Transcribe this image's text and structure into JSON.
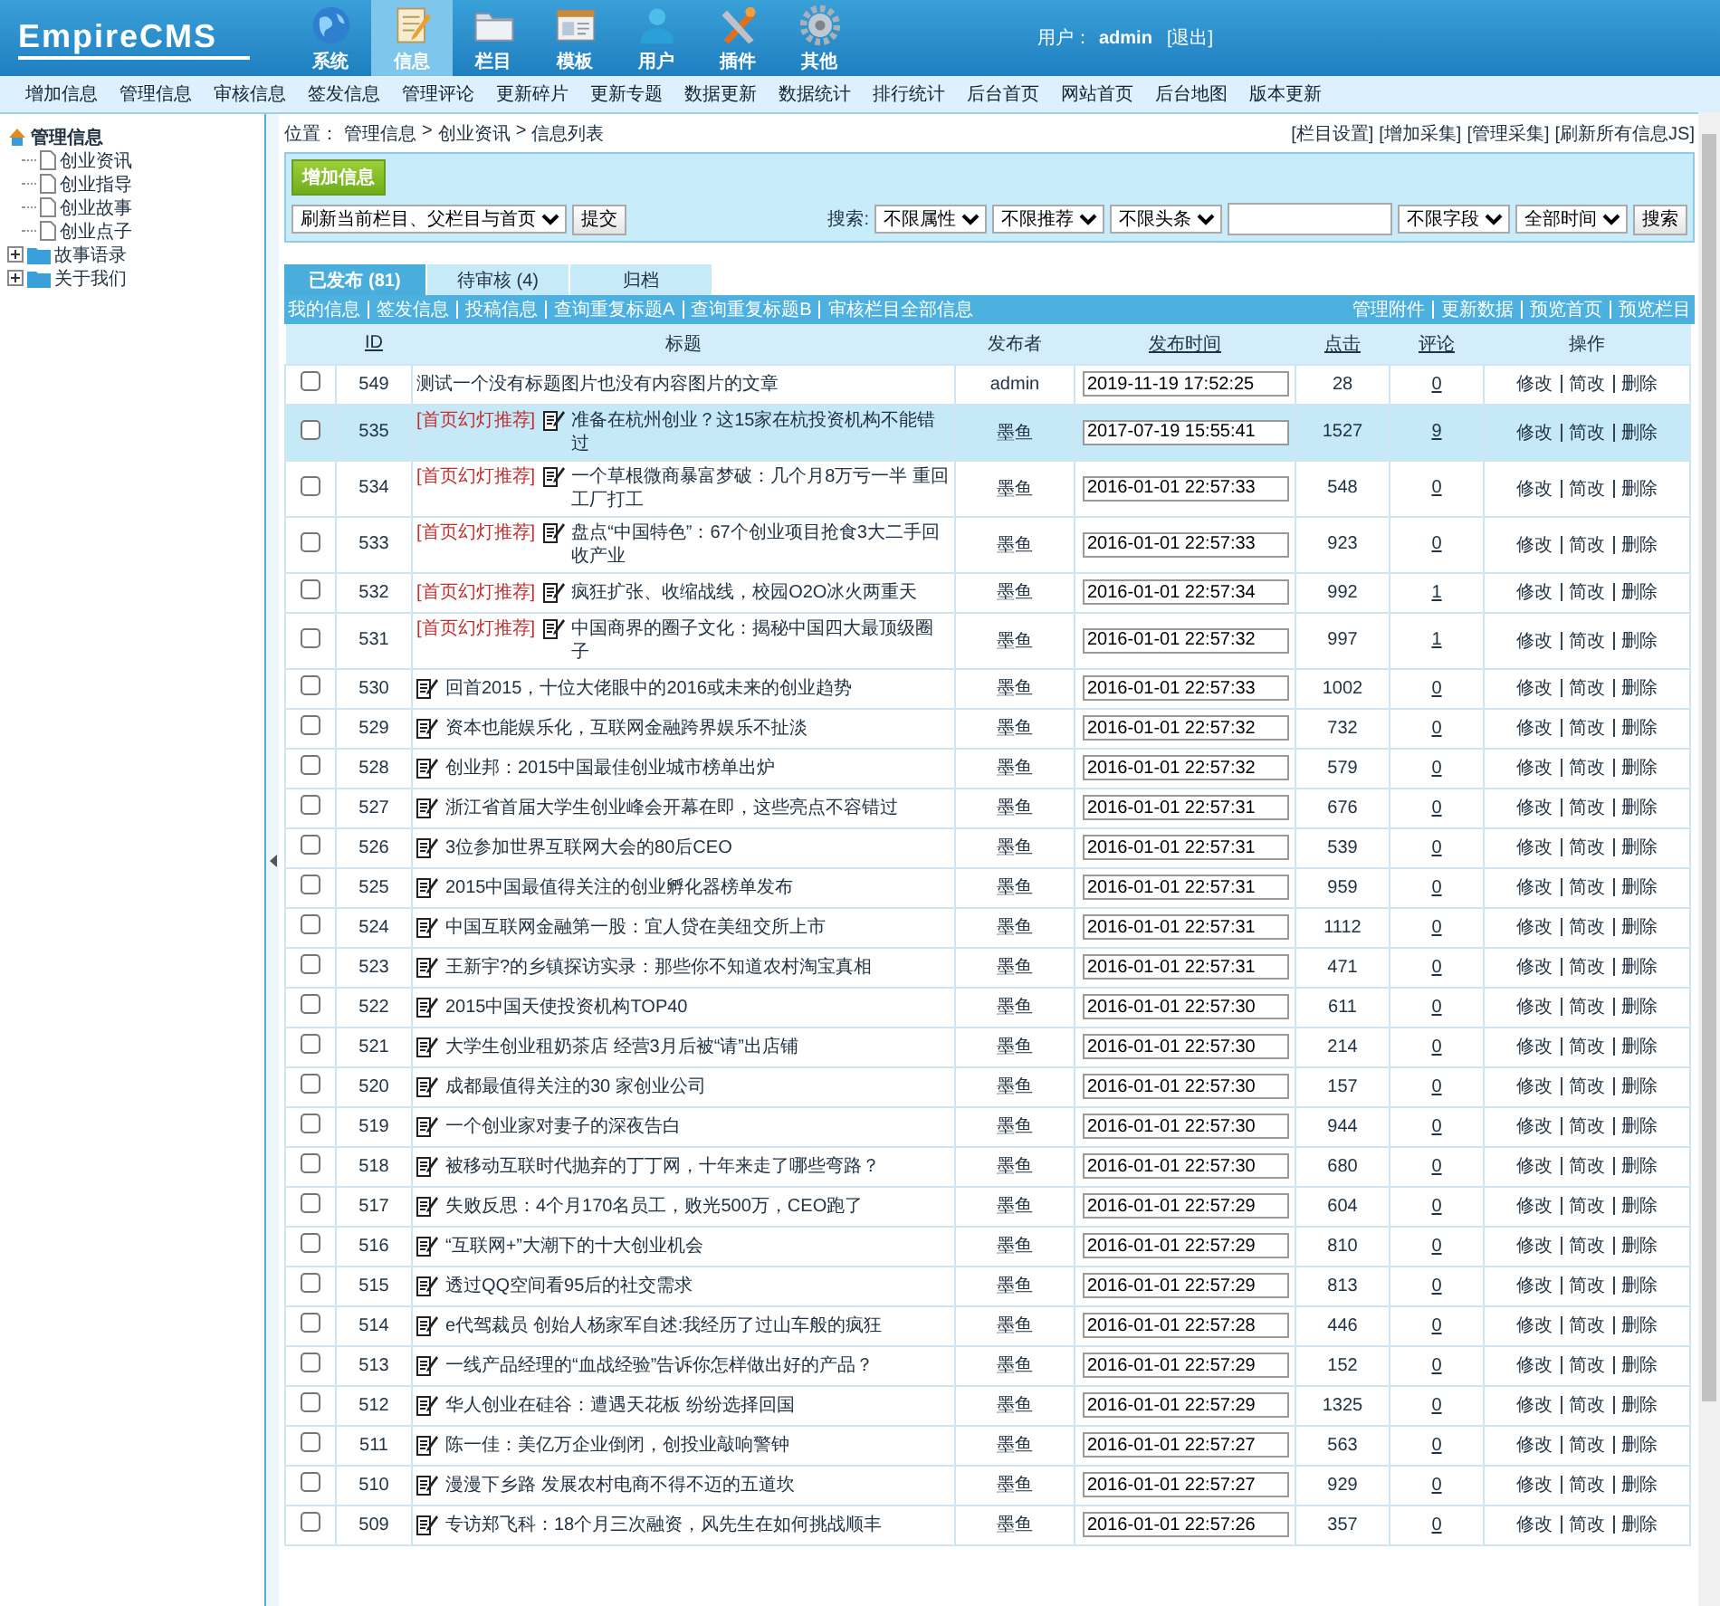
{
  "header": {
    "logo": "EmpireCMS",
    "main_nav": [
      {
        "label": "系统",
        "selected": false
      },
      {
        "label": "信息",
        "selected": true
      },
      {
        "label": "栏目",
        "selected": false
      },
      {
        "label": "模板",
        "selected": false
      },
      {
        "label": "用户",
        "selected": false
      },
      {
        "label": "插件",
        "selected": false
      },
      {
        "label": "其他",
        "selected": false
      }
    ],
    "user_label": "用户：",
    "user_name": "admin",
    "logout": "[退出]"
  },
  "sub_nav": [
    "增加信息",
    "管理信息",
    "审核信息",
    "签发信息",
    "管理评论",
    "更新碎片",
    "更新专题",
    "数据更新",
    "数据统计",
    "排行统计",
    "后台首页",
    "网站首页",
    "后台地图",
    "版本更新"
  ],
  "sidebar": {
    "tree": [
      {
        "label": "管理信息",
        "expanded": true,
        "children": [
          {
            "label": "创业资讯"
          },
          {
            "label": "创业指导"
          },
          {
            "label": "创业故事"
          },
          {
            "label": "创业点子"
          }
        ]
      },
      {
        "label": "故事语录",
        "expanded": false
      },
      {
        "label": "关于我们",
        "expanded": false
      }
    ]
  },
  "breadcrumb": {
    "prefix": "位置：",
    "items": [
      {
        "label": "管理信息"
      },
      {
        "separator": ">",
        "label": "创业资讯"
      },
      {
        "separator": ">",
        "label": "信息列表"
      }
    ]
  },
  "top_links": [
    "[栏目设置]",
    "[增加采集]",
    "[管理采集]",
    "[刷新所有信息JS]"
  ],
  "add_button": "增加信息",
  "refresh": {
    "select": "刷新当前栏目、父栏目与首页",
    "button": "提交"
  },
  "search": {
    "label": "搜索:",
    "filters": [
      "不限属性",
      "不限推荐",
      "不限头条"
    ],
    "field_select": "不限字段",
    "time_select": "全部时间",
    "button": "搜索"
  },
  "tabs": [
    {
      "label": "已发布 (81)",
      "selected": true
    },
    {
      "label": "待审核 (4)",
      "selected": false
    },
    {
      "label": "归档",
      "selected": false
    }
  ],
  "left_links": [
    "我的信息",
    "签发信息",
    "投稿信息",
    "查询重复标题A",
    "查询重复标题B",
    "审核栏目全部信息"
  ],
  "right_links": [
    "管理附件",
    "更新数据",
    "预览首页",
    "预览栏目"
  ],
  "columns": [
    {
      "label": "ID",
      "sortable": true
    },
    {
      "label": "标题",
      "sortable": false
    },
    {
      "label": "发布者",
      "sortable": false
    },
    {
      "label": "发布时间",
      "sortable": true
    },
    {
      "label": "点击",
      "sortable": true
    },
    {
      "label": "评论",
      "sortable": true
    },
    {
      "label": "操作",
      "sortable": false
    }
  ],
  "rows": [
    {
      "id": "549",
      "title": "测试一个没有标题图片也没有内容图片的文章",
      "has_image": false,
      "publisher": "admin",
      "time": "2019-11-19 17:52:25",
      "hits": "28",
      "comments": "0",
      "checked": false,
      "selected": false,
      "actions": [
        "修改",
        "简改",
        "删除"
      ]
    },
    {
      "id": "535",
      "tag": "[首页幻灯推荐]",
      "title": "准备在杭州创业？这15家在杭投资机构不能错过",
      "has_image": true,
      "publisher": "墨鱼",
      "time": "2017-07-19 15:55:41",
      "hits": "1527",
      "comments": "9",
      "checked": false,
      "selected": true,
      "actions": [
        "修改",
        "简改",
        "删除"
      ]
    },
    {
      "id": "534",
      "tag": "[首页幻灯推荐]",
      "title": "一个草根微商暴富梦破：几个月8万亏一半 重回工厂打工",
      "has_image": true,
      "publisher": "墨鱼",
      "time": "2016-01-01 22:57:33",
      "hits": "548",
      "comments": "0",
      "checked": false,
      "selected": false,
      "actions": [
        "修改",
        "简改",
        "删除"
      ]
    },
    {
      "id": "533",
      "tag": "[首页幻灯推荐]",
      "title": "盘点“中国特色”：67个创业项目抢食3大二手回收产业",
      "has_image": true,
      "publisher": "墨鱼",
      "time": "2016-01-01 22:57:33",
      "hits": "923",
      "comments": "0",
      "checked": false,
      "selected": false,
      "actions": [
        "修改",
        "简改",
        "删除"
      ]
    },
    {
      "id": "532",
      "tag": "[首页幻灯推荐]",
      "title": "疯狂扩张、收缩战线，校园O2O冰火两重天",
      "has_image": true,
      "publisher": "墨鱼",
      "time": "2016-01-01 22:57:34",
      "hits": "992",
      "comments": "1",
      "checked": false,
      "selected": false,
      "actions": [
        "修改",
        "简改",
        "删除"
      ]
    },
    {
      "id": "531",
      "tag": "[首页幻灯推荐]",
      "title": "中国商界的圈子文化：揭秘中国四大最顶级圈子",
      "has_image": true,
      "publisher": "墨鱼",
      "time": "2016-01-01 22:57:32",
      "hits": "997",
      "comments": "1",
      "checked": false,
      "selected": false,
      "actions": [
        "修改",
        "简改",
        "删除"
      ]
    },
    {
      "id": "530",
      "title": "回首2015，十位大佬眼中的2016或未来的创业趋势",
      "has_image": true,
      "publisher": "墨鱼",
      "time": "2016-01-01 22:57:33",
      "hits": "1002",
      "comments": "0",
      "checked": false,
      "selected": false,
      "actions": [
        "修改",
        "简改",
        "删除"
      ]
    },
    {
      "id": "529",
      "title": "资本也能娱乐化，互联网金融跨界娱乐不扯淡",
      "has_image": true,
      "publisher": "墨鱼",
      "time": "2016-01-01 22:57:32",
      "hits": "732",
      "comments": "0",
      "checked": false,
      "selected": false,
      "actions": [
        "修改",
        "简改",
        "删除"
      ]
    },
    {
      "id": "528",
      "title": "创业邦：2015中国最佳创业城市榜单出炉",
      "has_image": true,
      "publisher": "墨鱼",
      "time": "2016-01-01 22:57:32",
      "hits": "579",
      "comments": "0",
      "checked": false,
      "selected": false,
      "actions": [
        "修改",
        "简改",
        "删除"
      ]
    },
    {
      "id": "527",
      "title": "浙江省首届大学生创业峰会开幕在即，这些亮点不容错过",
      "has_image": true,
      "publisher": "墨鱼",
      "time": "2016-01-01 22:57:31",
      "hits": "676",
      "comments": "0",
      "checked": false,
      "selected": false,
      "actions": [
        "修改",
        "简改",
        "删除"
      ]
    },
    {
      "id": "526",
      "title": "3位参加世界互联网大会的80后CEO",
      "has_image": true,
      "publisher": "墨鱼",
      "time": "2016-01-01 22:57:31",
      "hits": "539",
      "comments": "0",
      "checked": false,
      "selected": false,
      "actions": [
        "修改",
        "简改",
        "删除"
      ]
    },
    {
      "id": "525",
      "title": "2015中国最值得关注的创业孵化器榜单发布",
      "has_image": true,
      "publisher": "墨鱼",
      "time": "2016-01-01 22:57:31",
      "hits": "959",
      "comments": "0",
      "checked": false,
      "selected": false,
      "actions": [
        "修改",
        "简改",
        "删除"
      ]
    },
    {
      "id": "524",
      "title": "中国互联网金融第一股：宜人贷在美纽交所上市",
      "has_image": true,
      "publisher": "墨鱼",
      "time": "2016-01-01 22:57:31",
      "hits": "1112",
      "comments": "0",
      "checked": false,
      "selected": false,
      "actions": [
        "修改",
        "简改",
        "删除"
      ]
    },
    {
      "id": "523",
      "title": "王新宇?的乡镇探访实录：那些你不知道农村淘宝真相",
      "has_image": true,
      "publisher": "墨鱼",
      "time": "2016-01-01 22:57:31",
      "hits": "471",
      "comments": "0",
      "checked": false,
      "selected": false,
      "actions": [
        "修改",
        "简改",
        "删除"
      ]
    },
    {
      "id": "522",
      "title": "2015中国天使投资机构TOP40",
      "has_image": true,
      "publisher": "墨鱼",
      "time": "2016-01-01 22:57:30",
      "hits": "611",
      "comments": "0",
      "checked": false,
      "selected": false,
      "actions": [
        "修改",
        "简改",
        "删除"
      ]
    },
    {
      "id": "521",
      "title": "大学生创业租奶茶店 经营3月后被“请”出店铺",
      "has_image": true,
      "publisher": "墨鱼",
      "time": "2016-01-01 22:57:30",
      "hits": "214",
      "comments": "0",
      "checked": false,
      "selected": false,
      "actions": [
        "修改",
        "简改",
        "删除"
      ]
    },
    {
      "id": "520",
      "title": "成都最值得关注的30 家创业公司",
      "has_image": true,
      "publisher": "墨鱼",
      "time": "2016-01-01 22:57:30",
      "hits": "157",
      "comments": "0",
      "checked": false,
      "selected": false,
      "actions": [
        "修改",
        "简改",
        "删除"
      ]
    },
    {
      "id": "519",
      "title": "一个创业家对妻子的深夜告白",
      "has_image": true,
      "publisher": "墨鱼",
      "time": "2016-01-01 22:57:30",
      "hits": "944",
      "comments": "0",
      "checked": false,
      "selected": false,
      "actions": [
        "修改",
        "简改",
        "删除"
      ]
    },
    {
      "id": "518",
      "title": "被移动互联时代抛弃的丁丁网，十年来走了哪些弯路？",
      "has_image": true,
      "publisher": "墨鱼",
      "time": "2016-01-01 22:57:30",
      "hits": "680",
      "comments": "0",
      "checked": false,
      "selected": false,
      "actions": [
        "修改",
        "简改",
        "删除"
      ]
    },
    {
      "id": "517",
      "title": "失败反思：4个月170名员工，败光500万，CEO跑了",
      "has_image": true,
      "publisher": "墨鱼",
      "time": "2016-01-01 22:57:29",
      "hits": "604",
      "comments": "0",
      "checked": false,
      "selected": false,
      "actions": [
        "修改",
        "简改",
        "删除"
      ]
    },
    {
      "id": "516",
      "title": "“互联网+”大潮下的十大创业机会",
      "has_image": true,
      "publisher": "墨鱼",
      "time": "2016-01-01 22:57:29",
      "hits": "810",
      "comments": "0",
      "checked": false,
      "selected": false,
      "actions": [
        "修改",
        "简改",
        "删除"
      ]
    },
    {
      "id": "515",
      "title": "透过QQ空间看95后的社交需求",
      "has_image": true,
      "publisher": "墨鱼",
      "time": "2016-01-01 22:57:29",
      "hits": "813",
      "comments": "0",
      "checked": false,
      "selected": false,
      "actions": [
        "修改",
        "简改",
        "删除"
      ]
    },
    {
      "id": "514",
      "title": "e代驾裁员 创始人杨家军自述:我经历了过山车般的疯狂",
      "has_image": true,
      "publisher": "墨鱼",
      "time": "2016-01-01 22:57:28",
      "hits": "446",
      "comments": "0",
      "checked": false,
      "selected": false,
      "actions": [
        "修改",
        "简改",
        "删除"
      ]
    },
    {
      "id": "513",
      "title": "一线产品经理的“血战经验”告诉你怎样做出好的产品？",
      "has_image": true,
      "publisher": "墨鱼",
      "time": "2016-01-01 22:57:29",
      "hits": "152",
      "comments": "0",
      "checked": false,
      "selected": false,
      "actions": [
        "修改",
        "简改",
        "删除"
      ]
    },
    {
      "id": "512",
      "title": "华人创业在硅谷：遭遇天花板 纷纷选择回国",
      "has_image": true,
      "publisher": "墨鱼",
      "time": "2016-01-01 22:57:29",
      "hits": "1325",
      "comments": "0",
      "checked": false,
      "selected": false,
      "actions": [
        "修改",
        "简改",
        "删除"
      ]
    },
    {
      "id": "511",
      "title": "陈一佳：美亿万企业倒闭，创投业敲响警钟",
      "has_image": true,
      "publisher": "墨鱼",
      "time": "2016-01-01 22:57:27",
      "hits": "563",
      "comments": "0",
      "checked": false,
      "selected": false,
      "actions": [
        "修改",
        "简改",
        "删除"
      ]
    },
    {
      "id": "510",
      "title": "漫漫下乡路 发展农村电商不得不迈的五道坎",
      "has_image": true,
      "publisher": "墨鱼",
      "time": "2016-01-01 22:57:27",
      "hits": "929",
      "comments": "0",
      "checked": false,
      "selected": false,
      "actions": [
        "修改",
        "简改",
        "删除"
      ]
    },
    {
      "id": "509",
      "title": "专访郑飞科：18个月三次融资，风先生在如何挑战顺丰",
      "has_image": true,
      "publisher": "墨鱼",
      "time": "2016-01-01 22:57:26",
      "hits": "357",
      "comments": "0",
      "checked": false,
      "selected": false,
      "actions": [
        "修改",
        "简改",
        "删除"
      ]
    }
  ]
}
